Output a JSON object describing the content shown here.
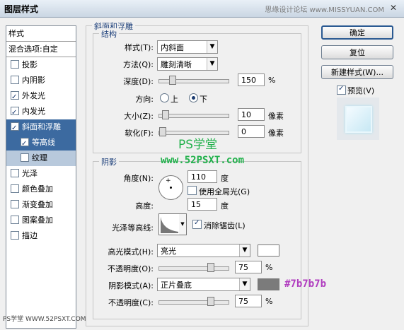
{
  "window": {
    "title": "图层样式",
    "watermark_top": "思缘设计论坛 www.MISSYUAN.COM"
  },
  "left": {
    "header": "样式",
    "header2": "混合选项:自定",
    "items": [
      {
        "label": "投影",
        "checked": false
      },
      {
        "label": "内阴影",
        "checked": false
      },
      {
        "label": "外发光",
        "checked": true
      },
      {
        "label": "内发光",
        "checked": true
      },
      {
        "label": "斜面和浮雕",
        "checked": true
      },
      {
        "label": "等高线",
        "checked": true
      },
      {
        "label": "纹理",
        "checked": false
      },
      {
        "label": "光泽",
        "checked": false
      },
      {
        "label": "颜色叠加",
        "checked": false
      },
      {
        "label": "渐变叠加",
        "checked": false
      },
      {
        "label": "图案叠加",
        "checked": false
      },
      {
        "label": "描边",
        "checked": false
      }
    ]
  },
  "bevel": {
    "title": "斜面和浮雕",
    "structure": {
      "title": "结构",
      "style_label": "样式(T):",
      "style_value": "内斜面",
      "technique_label": "方法(Q):",
      "technique_value": "雕刻清晰",
      "depth_label": "深度(D):",
      "depth_value": "150",
      "depth_unit": "%",
      "depth_fraction": 0.15,
      "direction_label": "方向:",
      "dir_up": "上",
      "dir_down": "下",
      "size_label": "大小(Z):",
      "size_value": "10",
      "size_unit": "像素",
      "size_fraction": 0.04,
      "soften_label": "软化(F):",
      "soften_value": "0",
      "soften_unit": "像素",
      "soften_fraction": 0.0
    },
    "shading": {
      "title": "阴影",
      "angle_label": "角度(N):",
      "angle_value": "110",
      "angle_unit": "度",
      "global_light_label": "使用全局光(G)",
      "altitude_label": "高度:",
      "altitude_value": "15",
      "altitude_unit": "度",
      "gloss_contour_label": "光泽等高线:",
      "antialias_label": "消除锯齿(L)",
      "highlight_mode_label": "高光模式(H):",
      "highlight_mode_value": "亮光",
      "highlight_color": "#ffffff",
      "opacity1_label": "不透明度(O):",
      "opacity1_value": "75",
      "opacity_unit": "%",
      "opacity1_fraction": 0.75,
      "shadow_mode_label": "阴影模式(A):",
      "shadow_mode_value": "正片叠底",
      "shadow_color": "#7b7b7b",
      "shadow_color_annotation": "#7b7b7b",
      "opacity2_label": "不透明度(C):",
      "opacity2_value": "75",
      "opacity2_fraction": 0.75
    }
  },
  "buttons": {
    "ok": "确定",
    "reset": "复位",
    "new_style": "新建样式(W)...",
    "preview": "预览(V)"
  },
  "watermarks": {
    "ps_center": "PS学堂",
    "url_center": "www.52PSXT.com",
    "bottom_left": "PS学堂 WWW.52PSXT.COM"
  },
  "accent_colors": {
    "selected": "#3c6aa0",
    "sub_selected": "#b8c9dc",
    "group_title": "#1c3f7a"
  }
}
